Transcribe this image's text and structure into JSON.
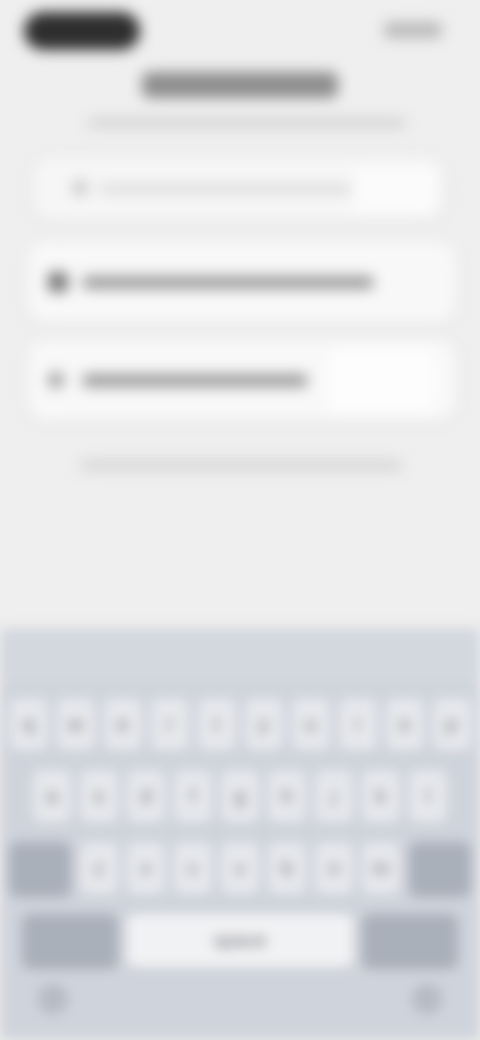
{
  "keyboard": {
    "rows": [
      [
        "q",
        "w",
        "e",
        "r",
        "t",
        "y",
        "u",
        "i",
        "o",
        "p"
      ],
      [
        "a",
        "s",
        "d",
        "f",
        "g",
        "h",
        "j",
        "k",
        "l"
      ],
      [
        "z",
        "x",
        "c",
        "v",
        "b",
        "n",
        "m"
      ]
    ],
    "space_label": "space"
  }
}
